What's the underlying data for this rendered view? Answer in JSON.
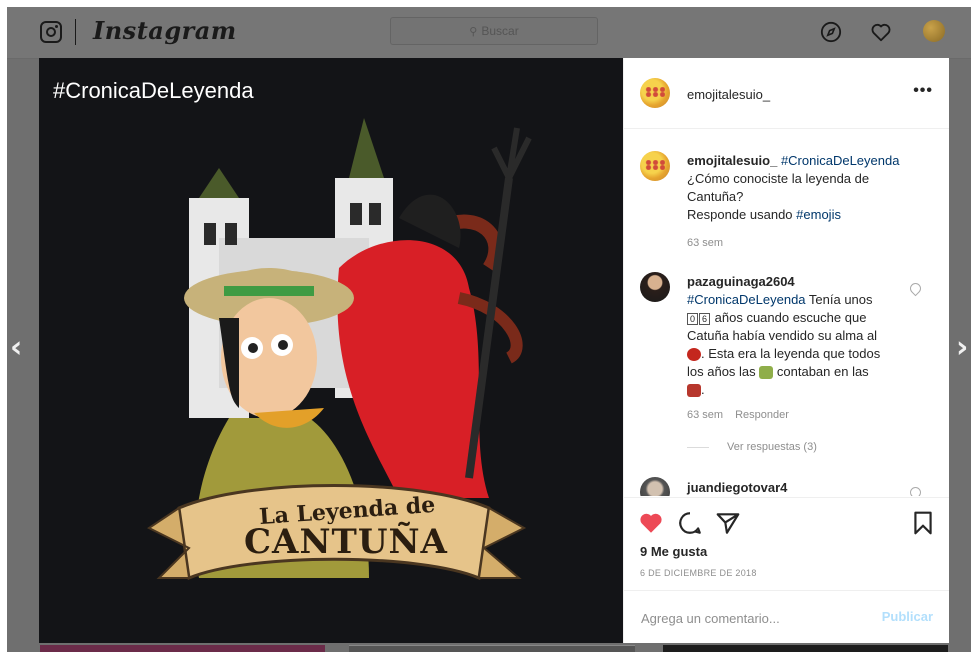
{
  "nav": {
    "app_name": "Instagram",
    "search_placeholder": "Buscar"
  },
  "post": {
    "photo_hashtag": "#CronicaDeLeyenda",
    "banner_top": "La Leyenda de",
    "banner_main": "CANTUÑA",
    "author": "emojitalesuio_",
    "more_label": "•••"
  },
  "comments": [
    {
      "user": "emojitalesuio_",
      "hashtag": "#CronicaDeLeyenda",
      "line1": "¿Cómo conociste la leyenda de",
      "line2": "Cantuña?",
      "line3_text": "Responde usando ",
      "line3_tag": "#emojis",
      "time": "63 sem"
    },
    {
      "user": "pazaguinaga2604",
      "hashtag": "#CronicaDeLeyenda",
      "text1": " Tenía unos",
      "key1": "0",
      "key2": "6",
      "text2": " años cuando escuche que",
      "text3": "Catuña había vendido su alma al",
      "text4": ". Esta era la leyenda que todos",
      "text5": "los años las",
      "text6": " contaban en las",
      "text7": ".",
      "time": "63 sem",
      "reply_label": "Responder",
      "view_replies": "Ver respuestas (3)"
    },
    {
      "user": "juandiegotovar4"
    }
  ],
  "actions": {
    "likes": "9 Me gusta",
    "date": "6 DE DICIEMBRE DE 2018",
    "comment_placeholder": "Agrega un comentario...",
    "publish_label": "Publicar"
  },
  "colors": {
    "like_red": "#ed4956",
    "link_blue": "#00376b",
    "publish_disabled": "#b2dffc"
  }
}
